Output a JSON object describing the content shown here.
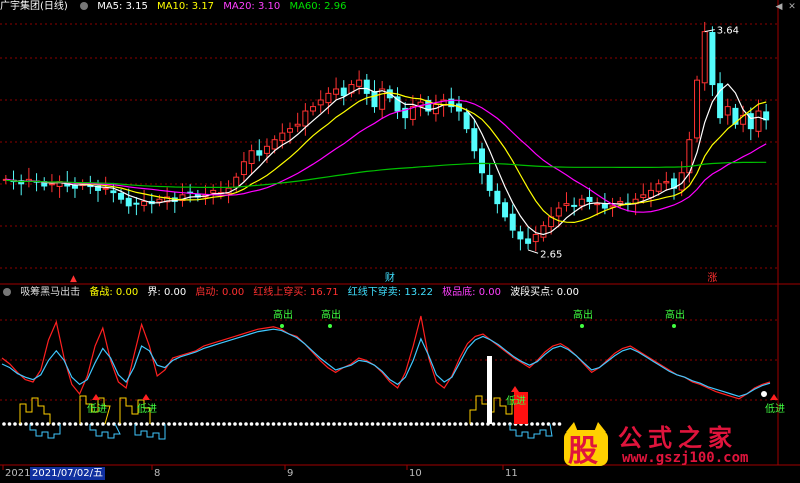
{
  "main_header": {
    "title": "广宇集团(日线)",
    "ma5": "MA5: 3.15",
    "ma10": "MA10: 3.17",
    "ma20": "MA20: 3.10",
    "ma60": "MA60: 2.96"
  },
  "sub_header": {
    "name": "吸筹黑马出击",
    "items": [
      {
        "text": "备战: 0.00",
        "color": "#ffff00"
      },
      {
        "text": "界: 0.00",
        "color": "#ffffff"
      },
      {
        "text": "启动: 0.00",
        "color": "#ff3030"
      },
      {
        "text": "红线上穿买: 16.71",
        "color": "#ff3030"
      },
      {
        "text": "红线下穿卖: 13.22",
        "color": "#40e0ff"
      },
      {
        "text": "极品底: 0.00",
        "color": "#ff40ff"
      },
      {
        "text": "波段买点: 0.00",
        "color": "#ffffff"
      }
    ]
  },
  "colors": {
    "up": "#ff3232",
    "down": "#54fcfc",
    "ma5": "#ffffff",
    "ma10": "#ffff00",
    "ma20": "#ff00ff",
    "ma60": "#00c000",
    "grid": "#8b0000"
  },
  "chart_data": [
    {
      "type": "candlestick",
      "title": "广宇集团(日线)",
      "ylim": [
        2.55,
        3.72
      ],
      "annotations": [
        {
          "label": "3.64",
          "value": 3.64,
          "kind": "high"
        },
        {
          "label": "2.65",
          "value": 2.65,
          "kind": "low"
        }
      ],
      "markers": [
        {
          "label": "财",
          "color": "#40e0ff"
        },
        {
          "label": "涨",
          "color": "#ff3030"
        }
      ],
      "closes": [
        2.97,
        2.96,
        2.95,
        2.97,
        2.96,
        2.94,
        2.95,
        2.96,
        2.94,
        2.93,
        2.95,
        2.94,
        2.92,
        2.93,
        2.91,
        2.88,
        2.85,
        2.86,
        2.87,
        2.86,
        2.88,
        2.89,
        2.87,
        2.9,
        2.91,
        2.89,
        2.9,
        2.92,
        2.91,
        2.93,
        2.98,
        3.05,
        3.1,
        3.08,
        3.12,
        3.15,
        3.18,
        3.2,
        3.22,
        3.28,
        3.3,
        3.33,
        3.36,
        3.38,
        3.35,
        3.4,
        3.42,
        3.36,
        3.3,
        3.38,
        3.34,
        3.28,
        3.25,
        3.3,
        3.32,
        3.28,
        3.31,
        3.33,
        3.3,
        3.28,
        3.2,
        3.1,
        3.0,
        2.92,
        2.86,
        2.8,
        2.74,
        2.7,
        2.68,
        2.72,
        2.76,
        2.8,
        2.84,
        2.86,
        2.85,
        2.88,
        2.87,
        2.86,
        2.84,
        2.85,
        2.87,
        2.86,
        2.88,
        2.9,
        2.92,
        2.95,
        2.96,
        2.93,
        3.0,
        3.15,
        3.42,
        3.64,
        3.4,
        3.25,
        3.3,
        3.22,
        3.26,
        3.2,
        3.28,
        3.24
      ]
    },
    {
      "type": "oscillator",
      "title": "吸筹黑马出击",
      "signals": [
        "高出",
        "高出",
        "高出",
        "高出",
        "低进",
        "低进",
        "低进",
        "低进"
      ],
      "red_line": [
        60,
        55,
        48,
        42,
        40,
        50,
        75,
        90,
        60,
        38,
        30,
        45,
        70,
        85,
        58,
        40,
        35,
        62,
        88,
        70,
        45,
        50,
        60,
        62,
        64,
        66,
        70,
        72,
        74,
        76,
        78,
        80,
        82,
        84,
        85,
        86,
        84,
        80,
        78,
        72,
        65,
        58,
        52,
        48,
        52,
        55,
        60,
        58,
        54,
        48,
        40,
        35,
        48,
        70,
        95,
        60,
        40,
        35,
        45,
        60,
        72,
        78,
        80,
        75,
        70,
        65,
        60,
        56,
        52,
        58,
        65,
        70,
        72,
        68,
        62,
        55,
        48,
        52,
        58,
        64,
        68,
        70,
        66,
        62,
        58,
        54,
        50,
        46,
        44,
        40,
        38,
        35,
        32,
        30,
        28,
        26,
        30,
        35,
        38,
        40
      ],
      "cyan_line": [
        55,
        52,
        47,
        44,
        42,
        46,
        58,
        66,
        58,
        44,
        38,
        42,
        56,
        68,
        60,
        46,
        40,
        52,
        70,
        66,
        54,
        52,
        58,
        61,
        63,
        65,
        68,
        70,
        72,
        74,
        76,
        78,
        80,
        82,
        83,
        84,
        83,
        80,
        77,
        72,
        66,
        60,
        55,
        50,
        52,
        54,
        58,
        57,
        54,
        49,
        42,
        38,
        44,
        58,
        76,
        62,
        46,
        40,
        44,
        56,
        68,
        75,
        78,
        75,
        71,
        66,
        61,
        57,
        54,
        57,
        63,
        68,
        70,
        67,
        62,
        56,
        50,
        52,
        57,
        62,
        66,
        68,
        65,
        61,
        57,
        53,
        49,
        46,
        44,
        41,
        39,
        36,
        34,
        32,
        30,
        28,
        30,
        34,
        37,
        39
      ]
    }
  ],
  "xaxis": {
    "labels": [
      "2021",
      "8",
      "9",
      "10",
      "11"
    ],
    "date_box": "2021/07/02/五"
  },
  "watermark": {
    "badge_char": "股",
    "text": "公式之家",
    "url": "www.gszj100.com"
  }
}
